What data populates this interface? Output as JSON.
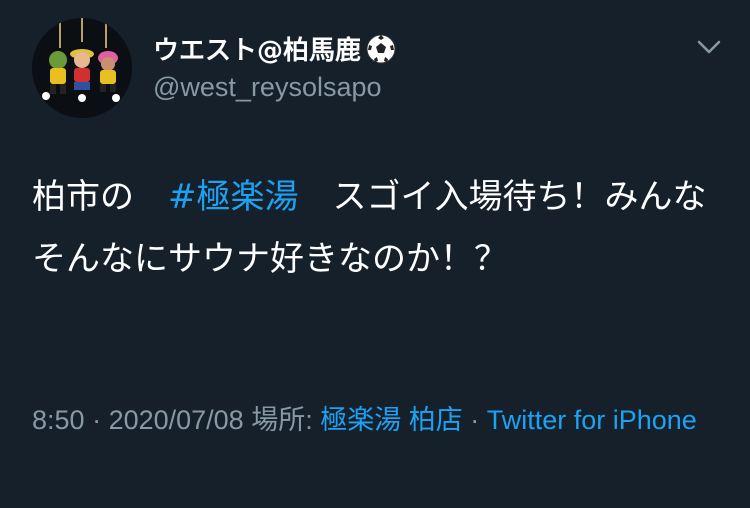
{
  "user": {
    "display_name": "ウエスト@柏馬鹿",
    "handle": "@west_reysolsapo",
    "avatar_icon": "figurine-keychain-avatar",
    "badge_icon": "soccer-ball-icon"
  },
  "menu_icon": "chevron-down-icon",
  "tweet": {
    "text_before": "柏市の　",
    "hashtag": "#極楽湯",
    "text_after": "　スゴイ入場待ち！みんなそんなにサウナ好きなのか！？"
  },
  "meta": {
    "time": "8:50",
    "separator1": " · ",
    "date": "2020/07/08",
    "place_prefix": " 場所: ",
    "place": "極楽湯 柏店",
    "separator2": " · ",
    "source": "Twitter for iPhone"
  },
  "colors": {
    "background": "#15202b",
    "text": "#ffffff",
    "muted": "#8899a6",
    "accent": "#1da1f2"
  }
}
